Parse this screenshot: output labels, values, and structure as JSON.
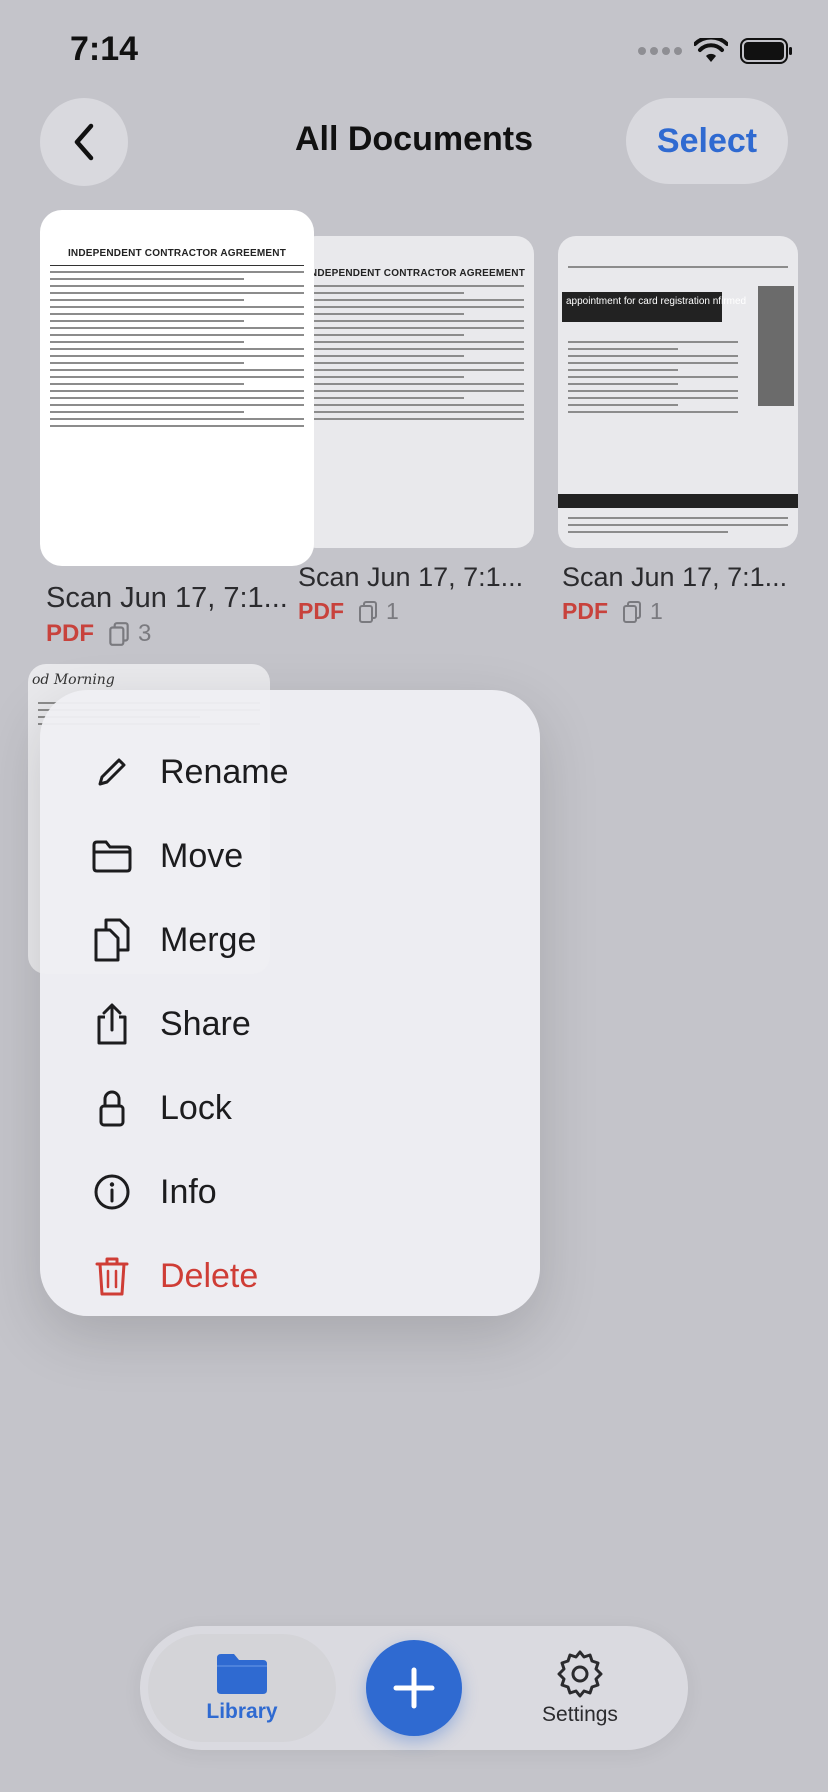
{
  "status_bar": {
    "time": "7:14"
  },
  "nav": {
    "title": "All Documents",
    "select_label": "Select"
  },
  "documents": [
    {
      "title": "Scan Jun 17, 7:1...",
      "type": "PDF",
      "pages": "3",
      "heading": "INDEPENDENT CONTRACTOR AGREEMENT"
    },
    {
      "title": "Scan Jun 17, 7:1...",
      "type": "PDF",
      "pages": "1",
      "heading": "INDEPENDENT CONTRACTOR AGREEMENT"
    },
    {
      "title": "Scan Jun 17, 7:1...",
      "type": "PDF",
      "pages": "1",
      "heading": "appointment for card registration nfirmed"
    },
    {
      "title": "",
      "type": "",
      "pages": "",
      "heading": "od Morning"
    }
  ],
  "context_menu": {
    "items": [
      {
        "label": "Rename",
        "icon": "pencil-icon"
      },
      {
        "label": "Move",
        "icon": "folder-icon"
      },
      {
        "label": "Merge",
        "icon": "merge-icon"
      },
      {
        "label": "Share",
        "icon": "share-icon"
      },
      {
        "label": "Lock",
        "icon": "lock-icon"
      },
      {
        "label": "Info",
        "icon": "info-icon"
      },
      {
        "label": "Delete",
        "icon": "trash-icon"
      }
    ]
  },
  "tab_bar": {
    "library_label": "Library",
    "settings_label": "Settings",
    "add_icon": "plus-icon"
  },
  "colors": {
    "accent": "#2f6ad1",
    "danger": "#cf3d36",
    "pdf": "#c8423c"
  }
}
